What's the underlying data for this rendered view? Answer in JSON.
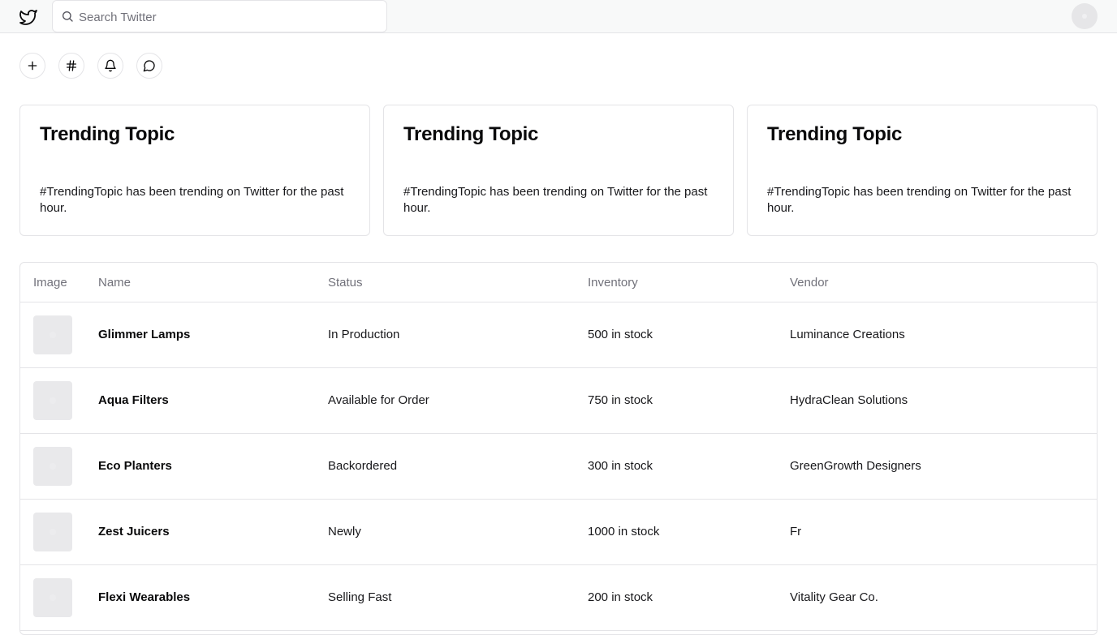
{
  "header": {
    "search_placeholder": "Search Twitter"
  },
  "icons": {
    "logo": "twitter-bird-icon",
    "search": "search-icon",
    "actions": [
      "plus-icon",
      "hashtag-icon",
      "bell-icon",
      "message-icon"
    ]
  },
  "cards": [
    {
      "title": "Trending Topic",
      "body": "#TrendingTopic has been trending on Twitter for the past hour."
    },
    {
      "title": "Trending Topic",
      "body": "#TrendingTopic has been trending on Twitter for the past hour."
    },
    {
      "title": "Trending Topic",
      "body": "#TrendingTopic has been trending on Twitter for the past hour."
    }
  ],
  "table": {
    "columns": [
      "Image",
      "Name",
      "Status",
      "Inventory",
      "Vendor"
    ],
    "rows": [
      {
        "name": "Glimmer Lamps",
        "status": "In Production",
        "inventory": "500 in stock",
        "vendor": "Luminance Creations"
      },
      {
        "name": "Aqua Filters",
        "status": "Available for Order",
        "inventory": "750 in stock",
        "vendor": "HydraClean Solutions"
      },
      {
        "name": "Eco Planters",
        "status": "Backordered",
        "inventory": "300 in stock",
        "vendor": "GreenGrowth Designers"
      },
      {
        "name": "Zest Juicers",
        "status": "Newly",
        "inventory": "1000 in stock",
        "vendor": "Fr"
      },
      {
        "name": "Flexi Wearables",
        "status": "Selling Fast",
        "inventory": "200 in stock",
        "vendor": "Vitality Gear Co."
      }
    ]
  }
}
